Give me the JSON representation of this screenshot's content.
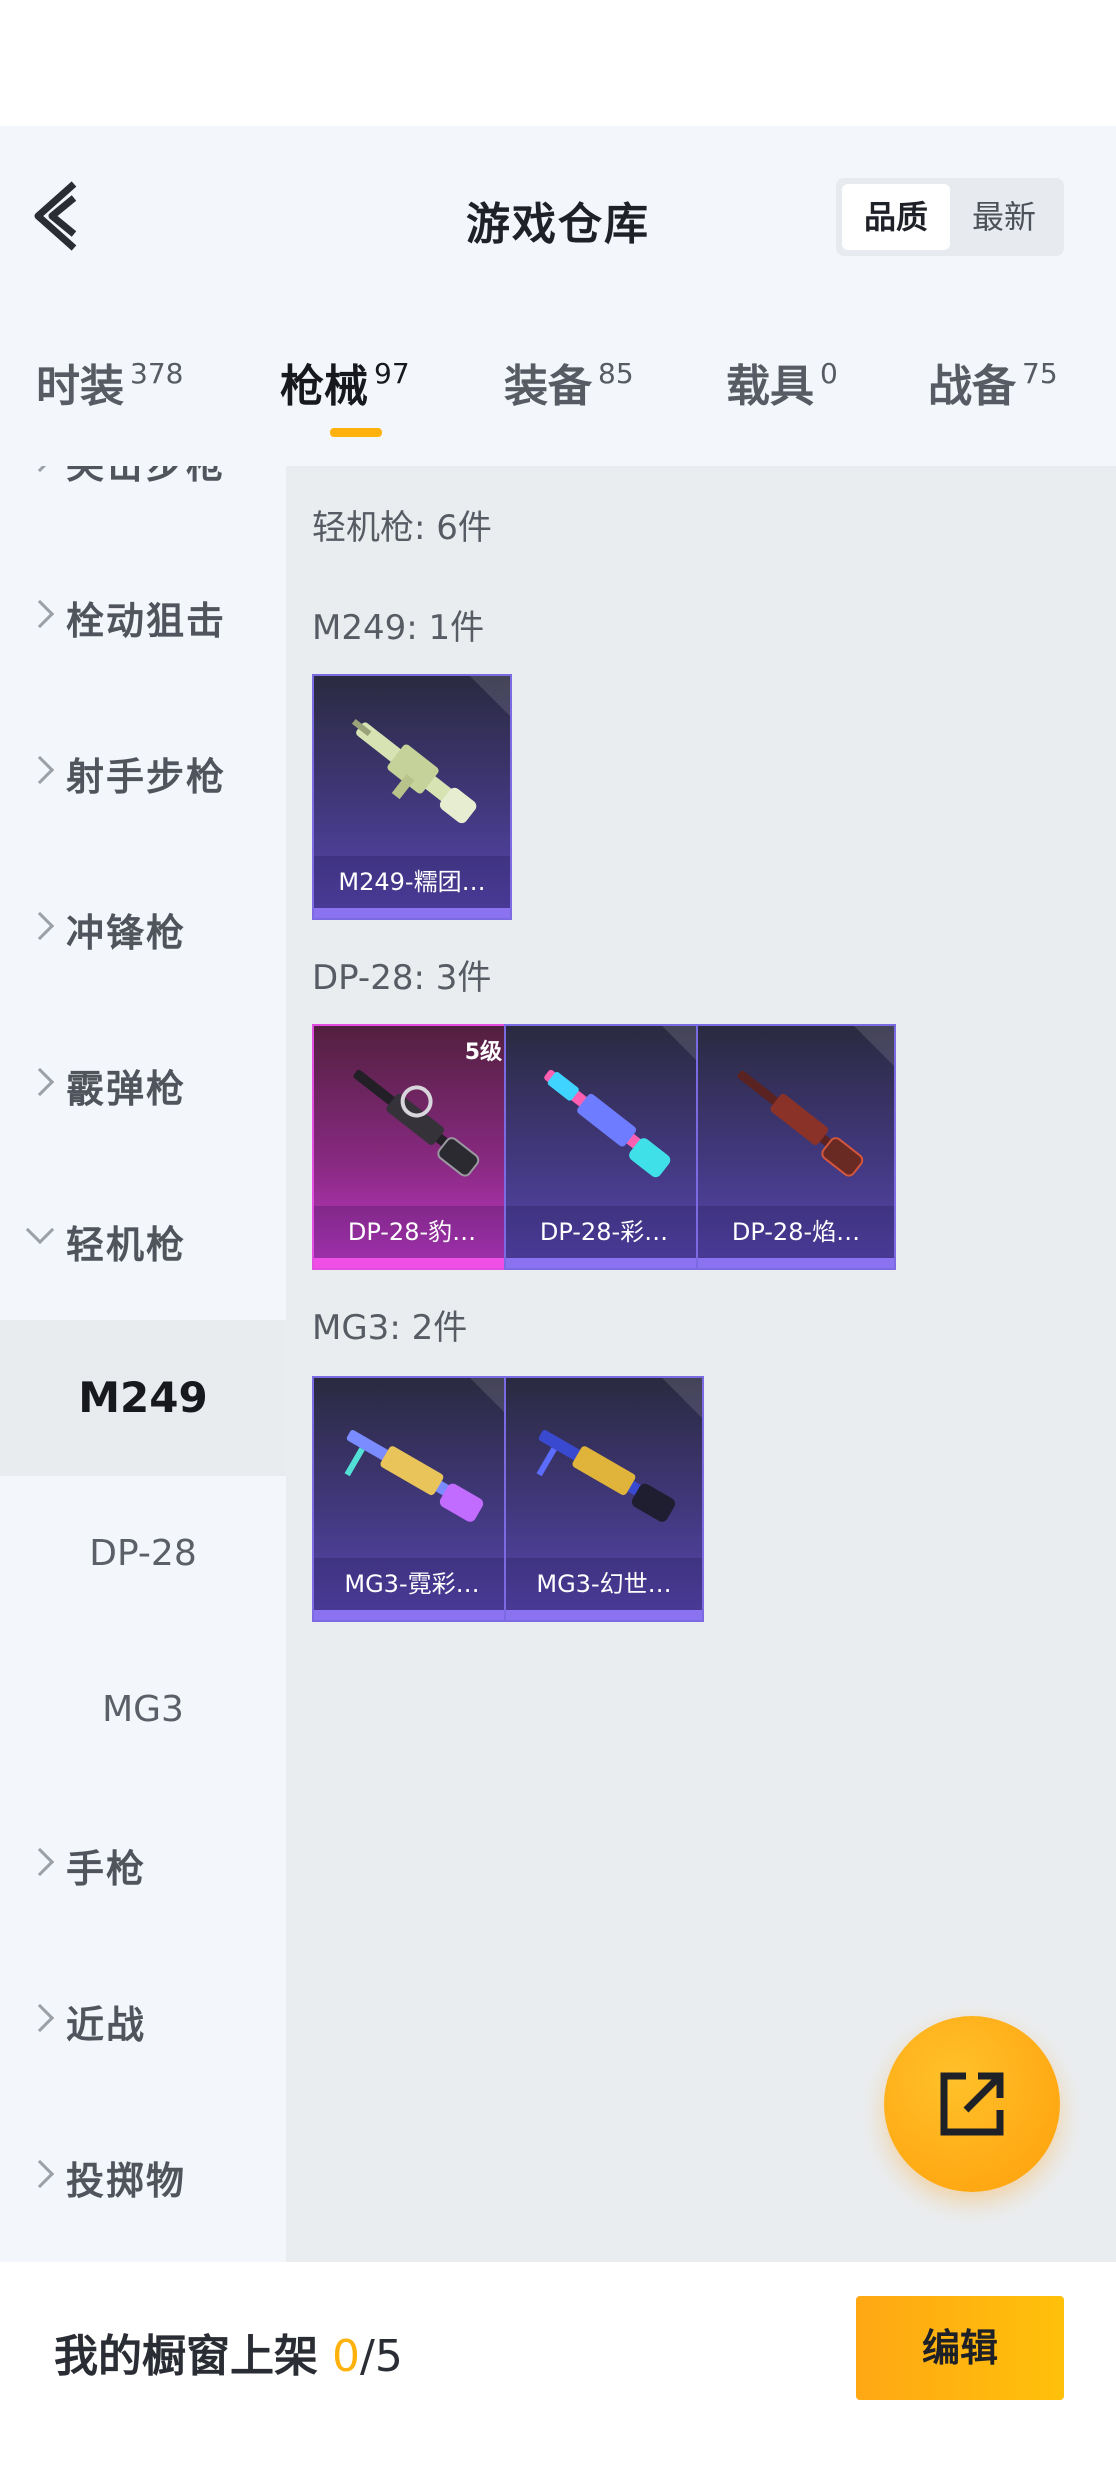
{
  "header": {
    "title": "游戏仓库",
    "sort": {
      "active": "品质",
      "other": "最新"
    }
  },
  "tabs": [
    {
      "label": "时装",
      "count": "378"
    },
    {
      "label": "枪械",
      "count": "97"
    },
    {
      "label": "装备",
      "count": "85"
    },
    {
      "label": "载具",
      "count": "0"
    },
    {
      "label": "战备",
      "count": "75"
    }
  ],
  "sidebar": {
    "categories": [
      {
        "label": "突击步枪"
      },
      {
        "label": "栓动狙击"
      },
      {
        "label": "射手步枪"
      },
      {
        "label": "冲锋枪"
      },
      {
        "label": "霰弹枪"
      },
      {
        "label": "轻机枪"
      },
      {
        "label": "手枪"
      },
      {
        "label": "近战"
      },
      {
        "label": "投掷物"
      }
    ],
    "subcategories": [
      {
        "label": "M249"
      },
      {
        "label": "DP-28"
      },
      {
        "label": "MG3"
      }
    ]
  },
  "content": {
    "section_title": "轻机枪: 6件",
    "groups": [
      {
        "title": "M249: 1件",
        "items": [
          {
            "name": "M249-糯团…"
          }
        ]
      },
      {
        "title": "DP-28: 3件",
        "items": [
          {
            "name": "DP-28-豹…",
            "level": "5级"
          },
          {
            "name": "DP-28-彩…"
          },
          {
            "name": "DP-28-焰…"
          }
        ]
      },
      {
        "title": "MG3: 2件",
        "items": [
          {
            "name": "MG3-霓彩…"
          },
          {
            "name": "MG3-幻世…"
          }
        ]
      }
    ]
  },
  "bottom": {
    "shelf_label": "我的橱窗上架",
    "shelf_current": "0",
    "shelf_total": "/5",
    "edit_label": "编辑"
  },
  "colors": {
    "accent": "#ffb20e",
    "sidebar_bg": "#f3f6fa",
    "content_bg": "#eaedf0",
    "card_purple": "#5b48b4",
    "card_pink": "#c93bcf"
  },
  "icons": [
    "back-arrow-icon",
    "chevron-right-icon",
    "chevron-down-icon",
    "share-external-icon"
  ]
}
